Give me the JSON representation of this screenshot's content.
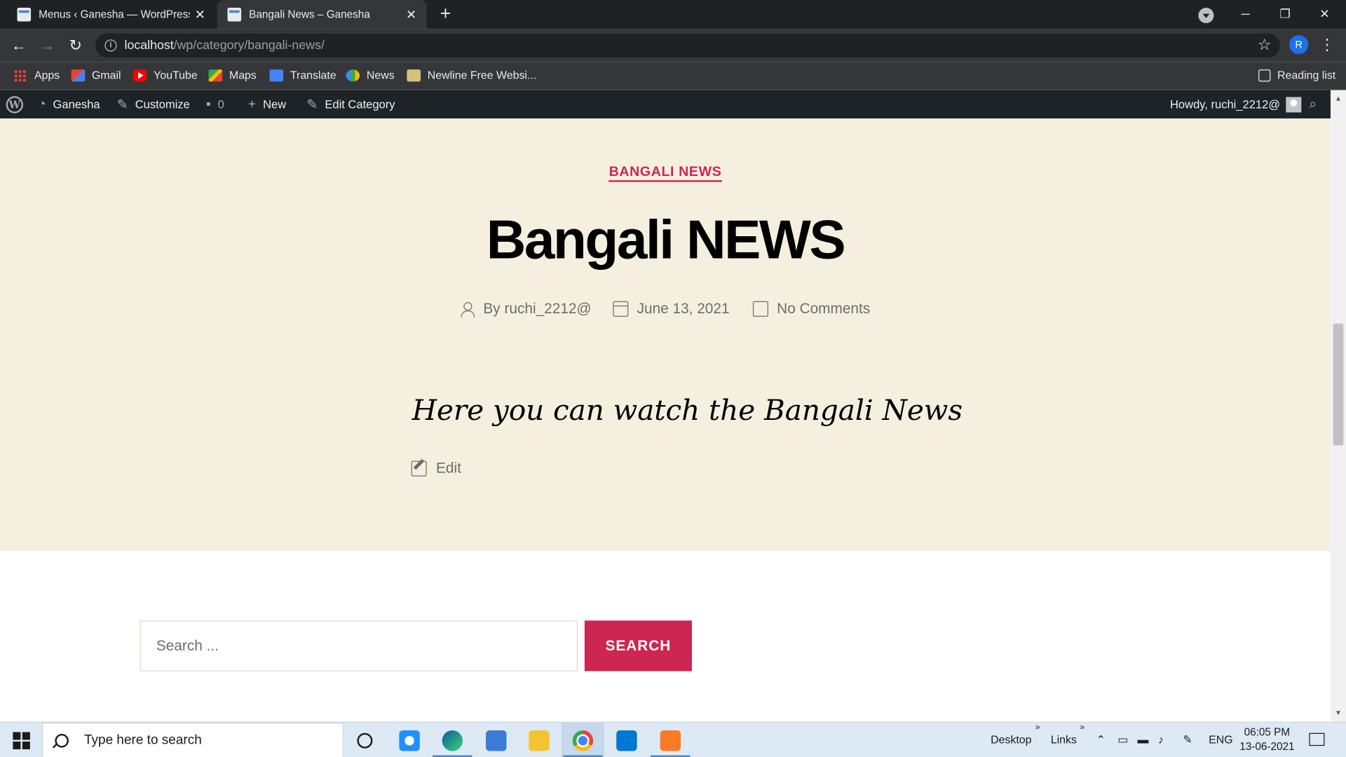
{
  "browser": {
    "tabs": [
      {
        "title": "Menus ‹ Ganesha — WordPress",
        "close": "✕"
      },
      {
        "title": "Bangali News – Ganesha",
        "close": "✕"
      }
    ],
    "new_tab": "+",
    "window_controls": {
      "minimize": "─",
      "restore": "❐",
      "close": "✕"
    },
    "url_host": "localhost",
    "url_path": "/wp/category/bangali-news/",
    "profile_initial": "R",
    "bookmarks": [
      "Apps",
      "Gmail",
      "YouTube",
      "Maps",
      "Translate",
      "News",
      "Newline Free Websi..."
    ],
    "reading_list": "Reading list"
  },
  "admin_bar": {
    "site": "Ganesha",
    "customize": "Customize",
    "comments_count": "0",
    "new": "New",
    "edit_category": "Edit Category",
    "howdy": "Howdy, ruchi_2212@"
  },
  "post": {
    "category": "BANGALI NEWS",
    "title": "Bangali NEWS",
    "author": "By ruchi_2212@",
    "date": "June 13, 2021",
    "comments": "No Comments",
    "content": "Here you can watch the Bangali News",
    "edit": "Edit"
  },
  "search": {
    "placeholder": "Search ...",
    "button": "SEARCH"
  },
  "taskbar": {
    "search_placeholder": "Type here to search",
    "desktop": "Desktop",
    "links": "Links",
    "chevron": "»",
    "language": "ENG",
    "time": "06:05 PM",
    "date": "13-06-2021"
  },
  "colors": {
    "accent": "#cd2653",
    "hero_bg": "#f5efe0",
    "admin_bar": "#1d2327",
    "chrome_dark": "#202124"
  }
}
